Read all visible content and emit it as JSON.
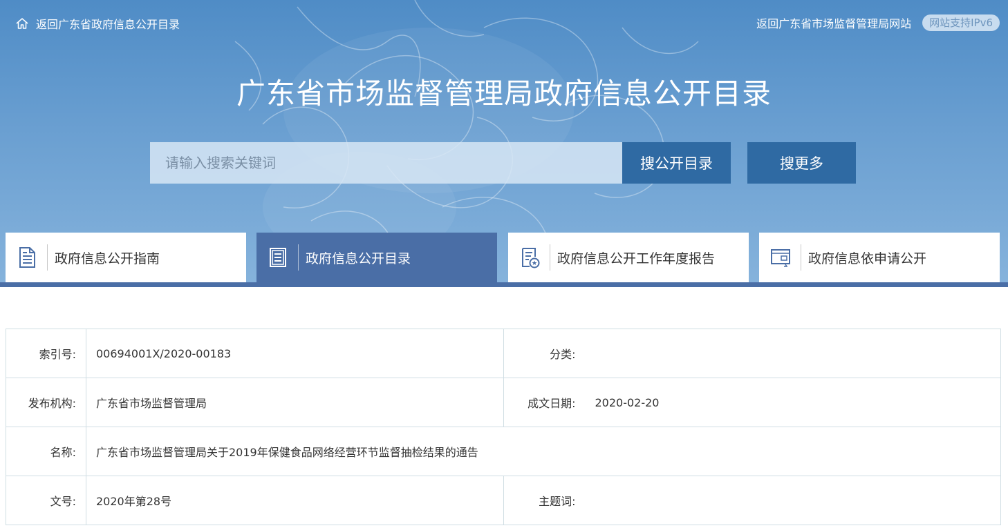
{
  "topbar": {
    "back_catalog_link": "返回广东省政府信息公开目录",
    "back_site_link": "返回广东省市场监督管理局网站",
    "ipv6_badge": "网站支持IPv6"
  },
  "header": {
    "title": "广东省市场监督管理局政府信息公开目录"
  },
  "search": {
    "placeholder": "请输入搜索关键词",
    "value": "",
    "search_catalog_button": "搜公开目录",
    "search_more_button": "搜更多"
  },
  "nav": {
    "tabs": [
      {
        "label": "政府信息公开指南",
        "icon": "document-lines-icon",
        "active": false
      },
      {
        "label": "政府信息公开目录",
        "icon": "catalog-list-icon",
        "active": true
      },
      {
        "label": "政府信息公开工作年度报告",
        "icon": "report-badge-icon",
        "active": false
      },
      {
        "label": "政府信息依申请公开",
        "icon": "application-screen-icon",
        "active": false
      }
    ]
  },
  "record": {
    "index_label": "索引号:",
    "index_value": "00694001X/2020-00183",
    "category_label": "分类:",
    "category_value": "",
    "publisher_label": "发布机构:",
    "publisher_value": "广东省市场监督管理局",
    "date_label": "成文日期:",
    "date_value": "2020-02-20",
    "name_label": "名称:",
    "name_value": "广东省市场监督管理局关于2019年保健食品网络经营环节监督抽检结果的通告",
    "doc_no_label": "文号:",
    "doc_no_value": "2020年第28号",
    "keywords_label": "主题词:",
    "keywords_value": ""
  },
  "colors": {
    "banner_top": "#4f8cc6",
    "banner_bottom": "#86b3dc",
    "button_blue": "#2f6aa3",
    "active_tab": "#4a6ea6",
    "table_border": "#cfdde3"
  }
}
